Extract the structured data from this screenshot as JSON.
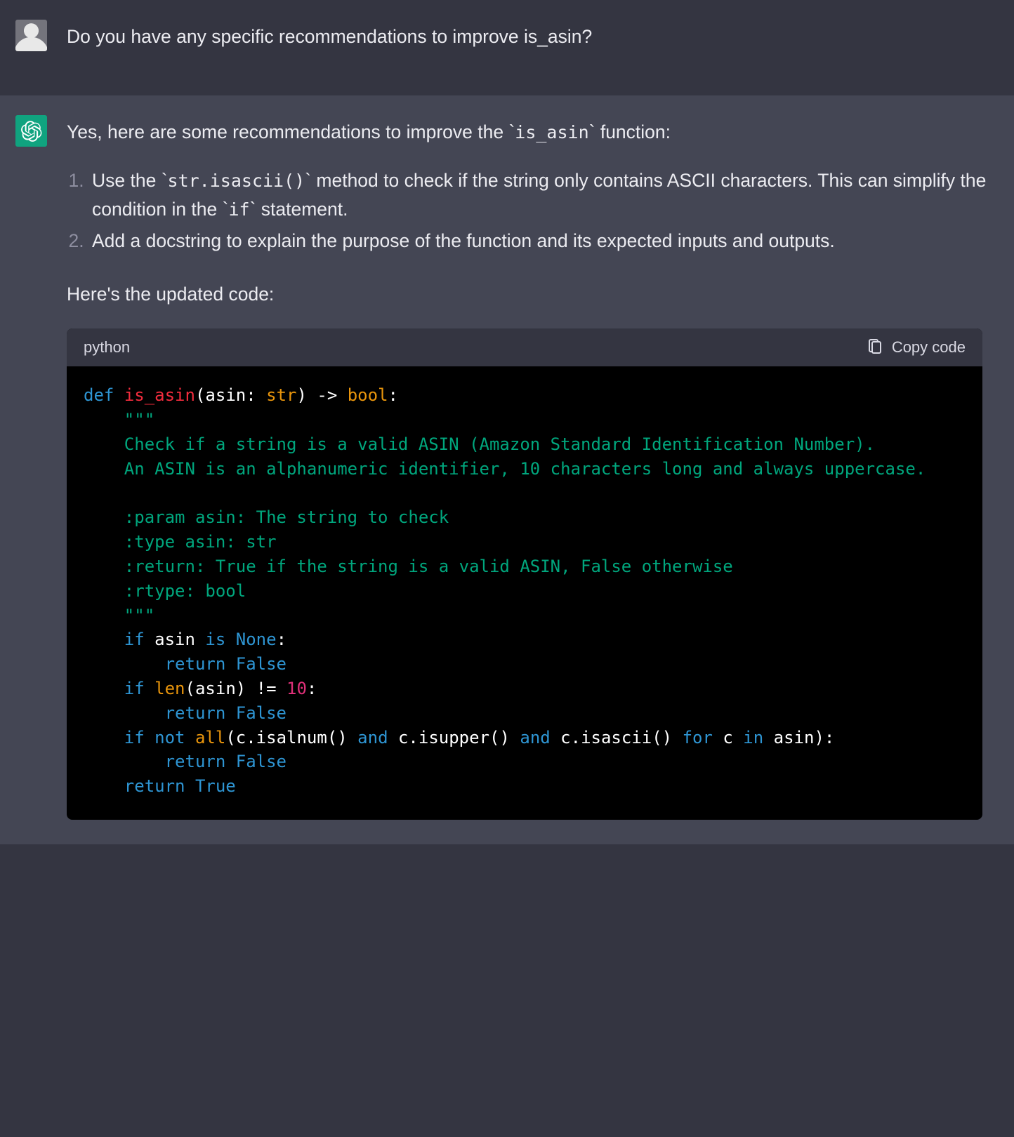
{
  "user_msg": {
    "text": "Do you have any specific recommendations to improve is_asin?"
  },
  "assistant_msg": {
    "intro_pre": "Yes, here are some recommendations to improve the ",
    "intro_code": "is_asin",
    "intro_post": " function:",
    "list": [
      {
        "t1": "Use the ",
        "c1": "str.isascii()",
        "t2": " method to check if the string only contains ASCII characters. This can simplify the condition in the ",
        "c2": "if",
        "t3": " statement."
      },
      {
        "t1": "Add a docstring to explain the purpose of the function and its expected inputs and outputs."
      }
    ],
    "after_list": "Here's the updated code:",
    "code": {
      "lang": "python",
      "copy_label": "Copy code",
      "tokens": {
        "def": "def",
        "name": "is_asin",
        "p1": "(asin: ",
        "str": "str",
        "p2": ") -> ",
        "bool": "bool",
        "p3": ":",
        "q": "\"\"\"",
        "d1": "Check if a string is a valid ASIN (Amazon Standard Identification Number).",
        "d2": "An ASIN is an alphanumeric identifier, 10 characters long and always uppercase.",
        "d3": ":param asin: The string to check",
        "d4": ":type asin: str",
        "d5": ":return: True if the string is a valid ASIN, False otherwise",
        "d6": ":rtype: bool",
        "if": "if",
        "is": "is",
        "none": "None",
        "ret": "return",
        "false": "False",
        "len": "len",
        "ne": " != ",
        "ten": "10",
        "not": "not",
        "all": "all",
        "and": "and",
        "for": "for",
        "in": "in",
        "true": "True",
        "l1a": " asin ",
        "l1b": ":",
        "l2a": "(asin)",
        "l2b": ":",
        "l3a": "(c.isalnum() ",
        "l3b": " c.isupper() ",
        "l3c": " c.isascii() ",
        "l3d": " c ",
        "l3e": " asin):"
      }
    }
  }
}
